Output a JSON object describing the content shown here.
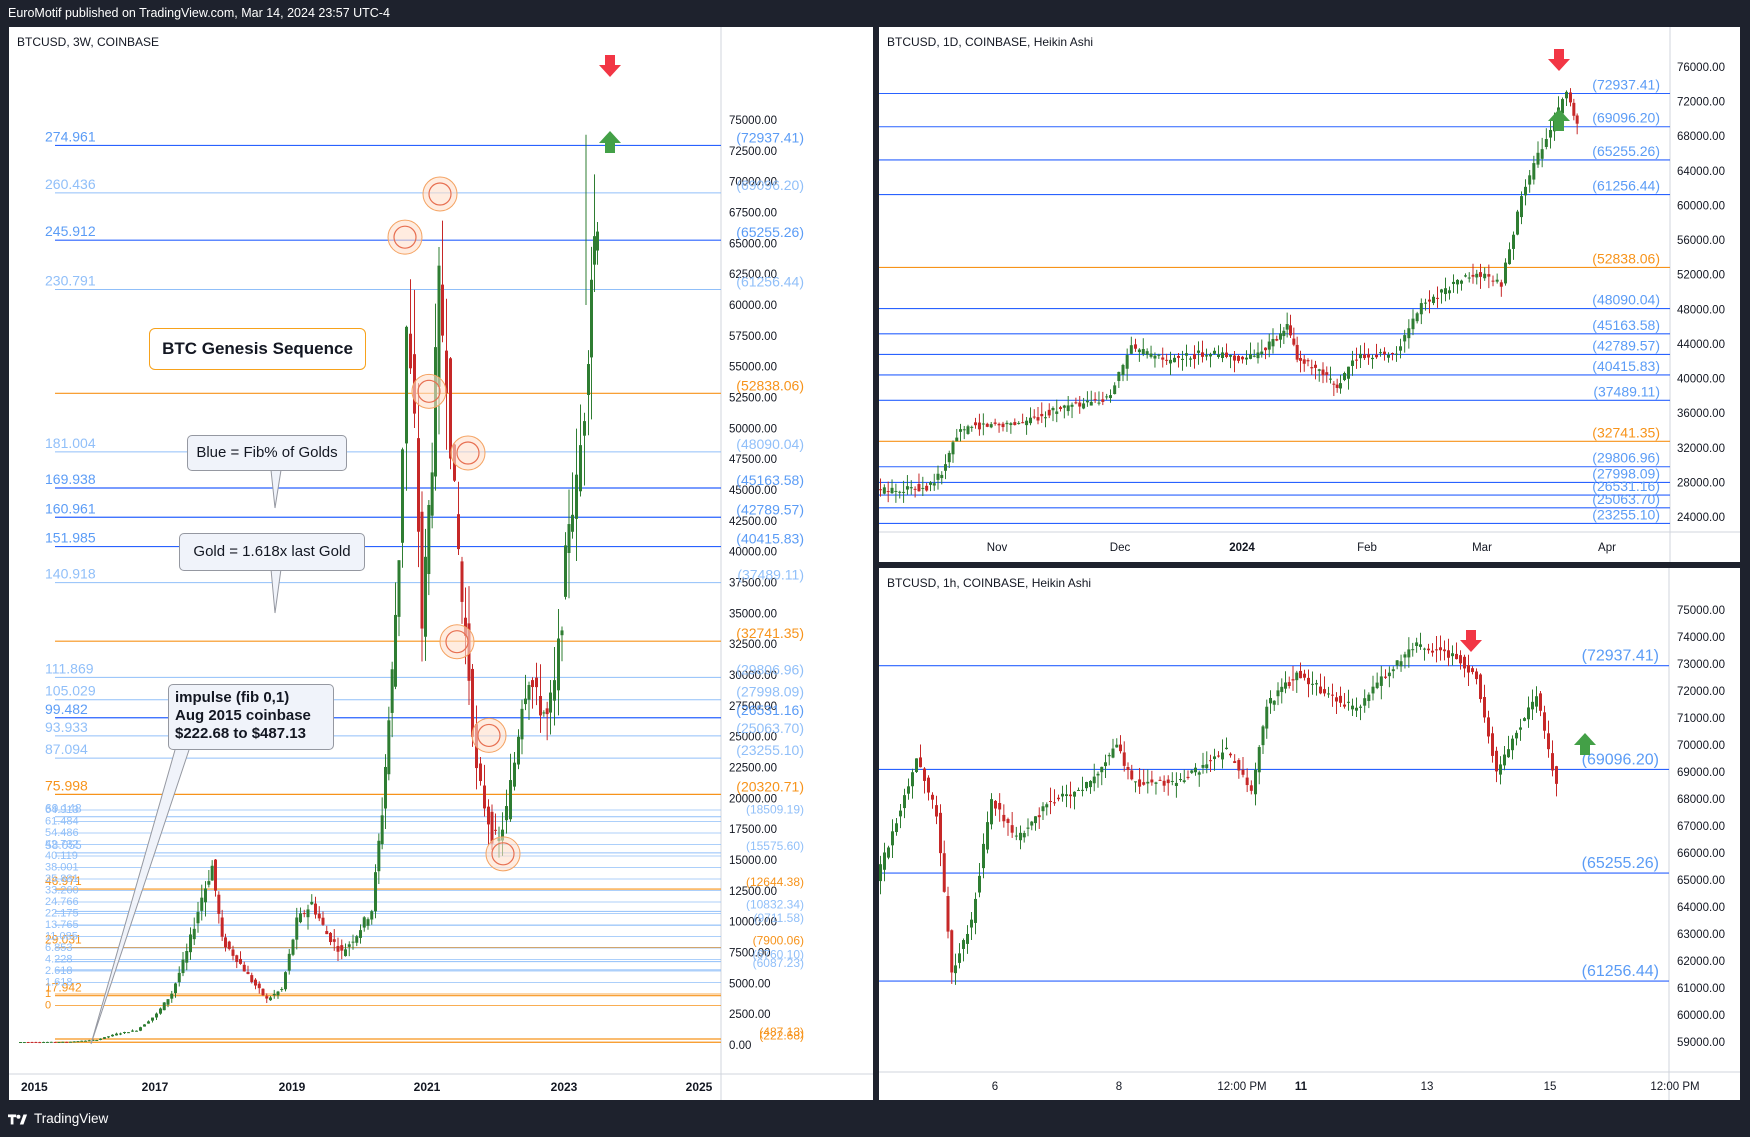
{
  "header": {
    "publish_text": "EuroMotif published on TradingView.com, Mar 14, 2024 23:57 UTC-4"
  },
  "footer": {
    "brand": "TradingView"
  },
  "colors": {
    "blue_line": "#2962ff",
    "blue_text": "#5b9cf6",
    "light_blue": "#90bff9",
    "gold": "#f7931a",
    "up": "#26a69a",
    "down": "#ef5350",
    "arrow_up": "#43a047",
    "arrow_down": "#f23645"
  },
  "panel_main": {
    "title": "BTCUSD, 3W, COINBASE",
    "price_scale": [
      "75000.00",
      "72500.00",
      "70000.00",
      "67500.00",
      "65000.00",
      "62500.00",
      "60000.00",
      "57500.00",
      "55000.00",
      "52500.00",
      "50000.00",
      "47500.00",
      "45000.00",
      "42500.00",
      "40000.00",
      "37500.00",
      "35000.00",
      "32500.00",
      "30000.00",
      "27500.00",
      "25000.00",
      "22500.00",
      "20000.00",
      "17500.00",
      "15000.00",
      "12500.00",
      "10000.00",
      "7500.00",
      "5000.00",
      "2500.00",
      "0.00"
    ],
    "time_labels": [
      "2015",
      "2017",
      "2019",
      "2021",
      "2023",
      "2025"
    ],
    "levels": [
      {
        "fib": "274.961",
        "price": "(72937.41)",
        "kind": "blue"
      },
      {
        "fib": "260.436",
        "price": "(69096.20)",
        "kind": "light"
      },
      {
        "fib": "245.912",
        "price": "(65255.26)",
        "kind": "blue"
      },
      {
        "fib": "230.791",
        "price": "(61256.44)",
        "kind": "light"
      },
      {
        "fib": "",
        "price": "(52838.06)",
        "kind": "gold"
      },
      {
        "fib": "181.004",
        "price": "(48090.04)",
        "kind": "light"
      },
      {
        "fib": "169.938",
        "price": "(45163.58)",
        "kind": "blue"
      },
      {
        "fib": "160.961",
        "price": "(42789.57)",
        "kind": "blue"
      },
      {
        "fib": "151.985",
        "price": "(40415.83)",
        "kind": "blue"
      },
      {
        "fib": "140.918",
        "price": "(37489.11)",
        "kind": "light"
      },
      {
        "fib": "",
        "price": "(32741.35)",
        "kind": "gold"
      },
      {
        "fib": "111.869",
        "price": "(29806.96)",
        "kind": "light"
      },
      {
        "fib": "105.029",
        "price": "(27998.09)",
        "kind": "light"
      },
      {
        "fib": "99.482",
        "price": "(26531.16)",
        "kind": "blue"
      },
      {
        "fib": "93.933",
        "price": "(25063.70)",
        "kind": "light"
      },
      {
        "fib": "87.094",
        "price": "(23255.10)",
        "kind": "light"
      },
      {
        "fib": "75.998",
        "price": "(20320.71)",
        "kind": "gold"
      },
      {
        "fib": "69.148",
        "price": "(18509.19)",
        "kind": "light"
      },
      {
        "fib": "58.055",
        "price": "(15575.60)",
        "kind": "light"
      },
      {
        "fib": "46.971",
        "price": "(12644.38)",
        "kind": "gold"
      },
      {
        "fib": "",
        "price": "(10832.34)",
        "kind": "light"
      },
      {
        "fib": "",
        "price": "(9711.58)",
        "kind": "light"
      },
      {
        "fib": "29.031",
        "price": "(7900.06)",
        "kind": "gold"
      },
      {
        "fib": "",
        "price": "(6760.10)",
        "kind": "light"
      },
      {
        "fib": "",
        "price": "(6087.23)",
        "kind": "light"
      },
      {
        "fib": "17.942",
        "price": "",
        "kind": "gold"
      },
      {
        "fib": "",
        "price": "(487.13)",
        "kind": "gold"
      },
      {
        "fib": "",
        "price": "(222.68)",
        "kind": "gold"
      }
    ],
    "small_fibs": [
      "64.913",
      "61.484",
      "54.486",
      "42.732",
      "40.119",
      "38.001",
      "35.881",
      "33.260",
      "24.766",
      "22.175",
      "13.765",
      "11.085",
      "6.853",
      "4.228",
      "2.618",
      "1.618",
      "1",
      "0"
    ],
    "callouts": {
      "genesis": "BTC Genesis Sequence",
      "blue": "Blue = Fib% of Golds",
      "gold": "Gold = 1.618x last Gold",
      "impulse_1": "impulse (fib 0,1)",
      "impulse_2": "Aug 2015 coinbase",
      "impulse_3": "$222.68 to $487.13"
    }
  },
  "panel_daily": {
    "title": "BTCUSD, 1D, COINBASE, Heikin Ashi",
    "price_scale": [
      "76000.00",
      "72000.00",
      "68000.00",
      "64000.00",
      "60000.00",
      "56000.00",
      "52000.00",
      "48000.00",
      "44000.00",
      "40000.00",
      "36000.00",
      "32000.00",
      "28000.00",
      "24000.00"
    ],
    "time_labels": [
      "Nov",
      "Dec",
      "2024",
      "Feb",
      "Mar",
      "Apr"
    ],
    "levels": [
      "(72937.41)",
      "(69096.20)",
      "(65255.26)",
      "(61256.44)",
      "(52838.06)",
      "(48090.04)",
      "(45163.58)",
      "(42789.57)",
      "(40415.83)",
      "(37489.11)",
      "(32741.35)",
      "(29806.96)",
      "(27998.09)",
      "(26531.16)",
      "(25063.70)",
      "(23255.10)"
    ]
  },
  "panel_hourly": {
    "title": "BTCUSD, 1h, COINBASE, Heikin Ashi",
    "price_scale": [
      "75000.00",
      "74000.00",
      "73000.00",
      "72000.00",
      "71000.00",
      "70000.00",
      "69000.00",
      "68000.00",
      "67000.00",
      "66000.00",
      "65000.00",
      "64000.00",
      "63000.00",
      "62000.00",
      "61000.00",
      "60000.00",
      "59000.00"
    ],
    "time_labels": [
      "6",
      "8",
      "12:00 PM",
      "11",
      "13",
      "15",
      "12:00 PM"
    ],
    "levels": [
      "(72937.41)",
      "(69096.20)",
      "(65255.26)",
      "(61256.44)"
    ]
  }
}
